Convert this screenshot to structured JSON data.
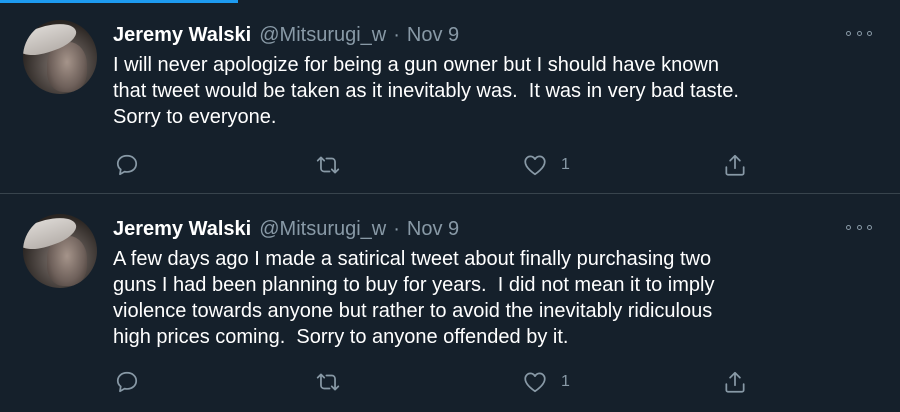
{
  "tweets": [
    {
      "name": "Jeremy Walski",
      "handle": "@Mitsurugi_w",
      "separator": "·",
      "date": "Nov 9",
      "text": "I will never apologize for being a gun owner but I should have known\nthat tweet would be taken as it inevitably was.  It was in very bad taste.\nSorry to everyone.",
      "likes": "1"
    },
    {
      "name": "Jeremy Walski",
      "handle": "@Mitsurugi_w",
      "separator": "·",
      "date": "Nov 9",
      "text": "A few days ago I made a satirical tweet about finally purchasing two\nguns I had been planning to buy for years.  I did not mean it to imply\nviolence towards anyone but rather to avoid the inevitably ridiculous\nhigh prices coming.  Sorry to anyone offended by it.",
      "likes": "1"
    }
  ],
  "icons": {
    "reply": "reply-icon",
    "retweet": "retweet-icon",
    "like": "heart-icon",
    "share": "share-icon",
    "more": "more-icon"
  },
  "colors": {
    "background": "#15202b",
    "secondary_text": "#8899a6",
    "divider": "#38444d",
    "accent": "#1d9bf0"
  }
}
